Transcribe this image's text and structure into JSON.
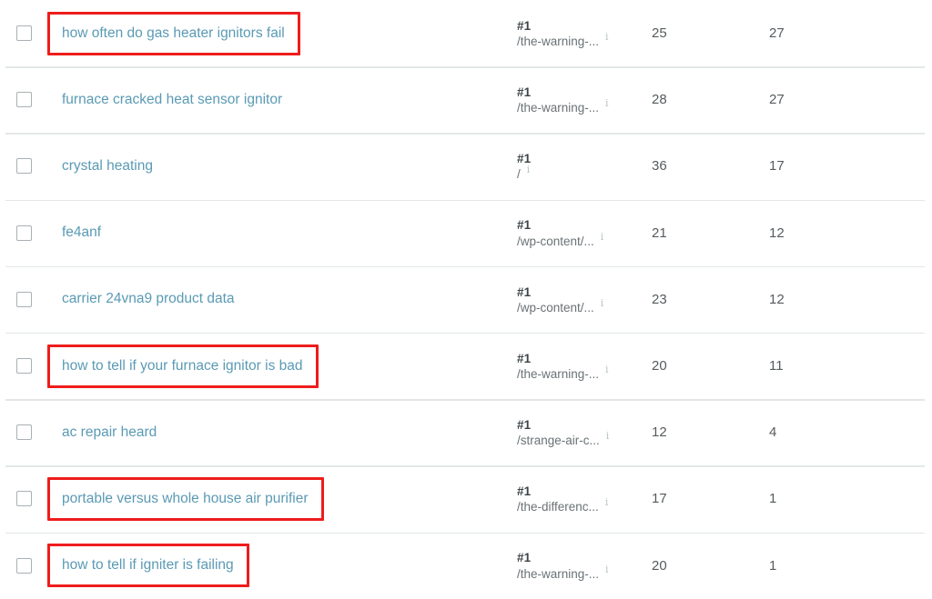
{
  "table": {
    "checkbox_icon": "checkbox-empty",
    "info_icon": "i",
    "rows": [
      {
        "keyword": "how often do gas heater ignitors fail",
        "highlighted": true,
        "rank": "#1",
        "url": "/the-warning-...",
        "metric_a": "25",
        "metric_b": "27"
      },
      {
        "keyword": "furnace cracked heat sensor ignitor",
        "highlighted": false,
        "rank": "#1",
        "url": "/the-warning-...",
        "metric_a": "28",
        "metric_b": "27"
      },
      {
        "keyword": "crystal heating",
        "highlighted": false,
        "rank": "#1",
        "url": "/",
        "metric_a": "36",
        "metric_b": "17"
      },
      {
        "keyword": "fe4anf",
        "highlighted": false,
        "rank": "#1",
        "url": "/wp-content/...",
        "metric_a": "21",
        "metric_b": "12"
      },
      {
        "keyword": "carrier 24vna9 product data",
        "highlighted": false,
        "rank": "#1",
        "url": "/wp-content/...",
        "metric_a": "23",
        "metric_b": "12"
      },
      {
        "keyword": "how to tell if your furnace ignitor is bad",
        "highlighted": true,
        "rank": "#1",
        "url": "/the-warning-...",
        "metric_a": "20",
        "metric_b": "11"
      },
      {
        "keyword": "ac repair heard",
        "highlighted": false,
        "rank": "#1",
        "url": "/strange-air-c...",
        "metric_a": "12",
        "metric_b": "4"
      },
      {
        "keyword": "portable versus whole house air purifier",
        "highlighted": true,
        "rank": "#1",
        "url": "/the-differenc...",
        "metric_a": "17",
        "metric_b": "1"
      },
      {
        "keyword": "how to tell if igniter is failing",
        "highlighted": true,
        "rank": "#1",
        "url": "/the-warning-...",
        "metric_a": "20",
        "metric_b": "1"
      }
    ]
  },
  "colors": {
    "link": "#5a9ab4",
    "highlight_border": "#ee1c1c",
    "row_divider": "#e3e7e8",
    "metric_text": "#555b5e",
    "rank_text": "#3d4447",
    "url_text": "#6a7275",
    "info_icon": "#b9c6c9",
    "checkbox_border": "#a9b0b3"
  }
}
